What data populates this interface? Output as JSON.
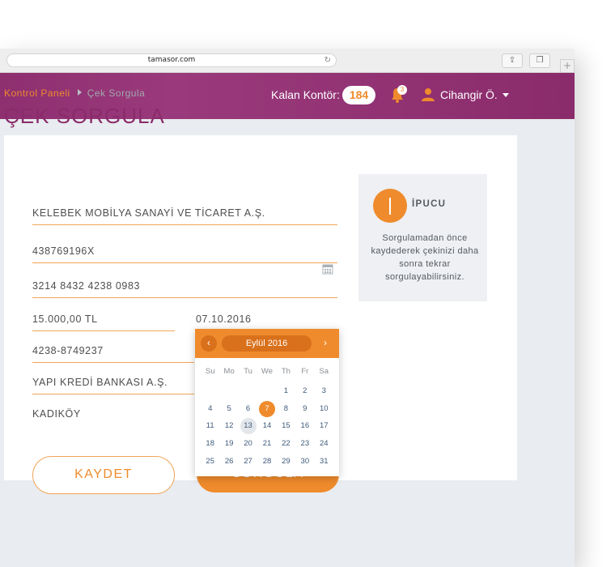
{
  "browser": {
    "url": "tamasor.com",
    "reload_icon": "reload-icon",
    "share_icon": "share-icon",
    "tabs_icon": "tabs-icon",
    "new_tab_label": "+"
  },
  "header": {
    "credits_label": "Kalan Kontör:",
    "credits_value": "184",
    "notification_count": "3",
    "user_name": "Cihangir Ö."
  },
  "breadcrumb": {
    "home": "Kontrol Paneli",
    "current": "Çek Sorgula"
  },
  "page_title": "ÇEK SORGULA",
  "form": {
    "company": "KELEBEK MOBİLYA SANAYİ VE TİCARET A.Ş.",
    "tax_number": "438769196X",
    "cheque_number": "3214 8432 4238 0983",
    "amount": "15.000,00 TL",
    "date": "07.10.2016",
    "account_number": "4238-8749237",
    "bank": "YAPI KREDİ BANKASI A.Ş.",
    "branch": "KADIKÖY",
    "save_label": "KAYDET",
    "query_label": "SORGULA"
  },
  "tip": {
    "title": "İPUCU",
    "text": "Sorgulamadan önce kaydederek çekinizi daha sonra tekrar sorgulayabilirsiniz."
  },
  "datepicker": {
    "month_label": "Eylül 2016",
    "prev": "‹",
    "next": "›",
    "weekdays": [
      "Su",
      "Mo",
      "Tu",
      "We",
      "Th",
      "Fr",
      "Sa"
    ],
    "weeks": [
      [
        "",
        "",
        "",
        "",
        "1",
        "2",
        "3"
      ],
      [
        "4",
        "5",
        "6",
        "7",
        "8",
        "9",
        "10"
      ],
      [
        "11",
        "12",
        "13",
        "14",
        "15",
        "16",
        "17"
      ],
      [
        "18",
        "19",
        "20",
        "21",
        "22",
        "23",
        "24"
      ],
      [
        "25",
        "26",
        "27",
        "28",
        "29",
        "30",
        "31"
      ]
    ],
    "selected_day": "7",
    "highlighted_day": "13"
  },
  "colors": {
    "brand": "#8a2b6b",
    "accent": "#ef8b2c"
  }
}
